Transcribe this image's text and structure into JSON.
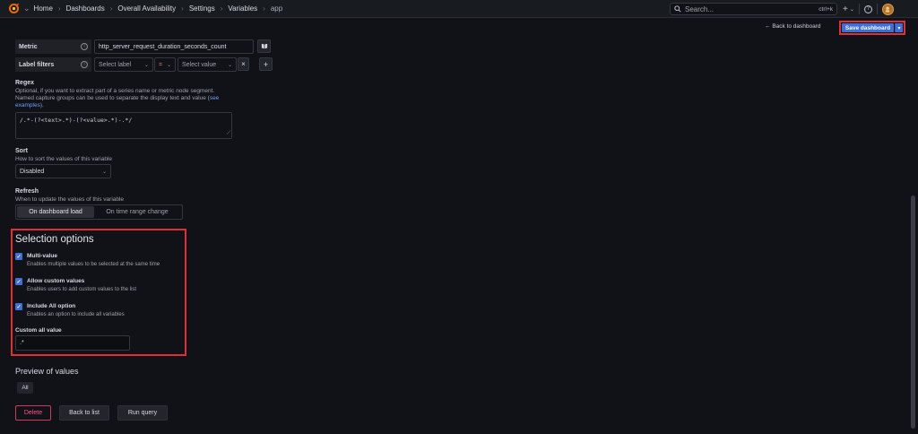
{
  "nav": {
    "breadcrumbs": [
      "Home",
      "Dashboards",
      "Overall Availability",
      "Settings",
      "Variables",
      "app"
    ],
    "search_placeholder": "Search...",
    "search_shortcut": "ctrl+k",
    "add_label": "+",
    "help_label": "?"
  },
  "toolbar": {
    "back_to_dashboard": "Back to dashboard",
    "save_dashboard": "Save dashboard"
  },
  "query": {
    "metric_label": "Metric",
    "metric_value": "http_server_request_duration_seconds_count",
    "label_filters_label": "Label filters",
    "select_label_placeholder": "Select label",
    "operator": "=",
    "select_value_placeholder": "Select value"
  },
  "regex": {
    "label": "Regex",
    "description_1": "Optional, if you want to extract part of a series name or metric node segment.",
    "description_2": "Named capture groups can be used to separate the display text and value (",
    "link_text_1": "see",
    "link_text_2": "examples",
    "description_end": ").",
    "value": "/.*-(?<text>.*)-(?<value>.*)-.*/"
  },
  "sort": {
    "label": "Sort",
    "description": "How to sort the values of this variable",
    "value": "Disabled"
  },
  "refresh": {
    "label": "Refresh",
    "description": "When to update the values of this variable",
    "options": [
      "On dashboard load",
      "On time range change"
    ],
    "selected": "On dashboard load"
  },
  "selection": {
    "title": "Selection options",
    "multi_value_label": "Multi-value",
    "multi_value_desc": "Enables multiple values to be selected at the same time",
    "custom_values_label": "Allow custom values",
    "custom_values_desc": "Enables users to add custom values to the list",
    "include_all_label": "Include All option",
    "include_all_desc": "Enables an option to include all variables",
    "custom_all_label": "Custom all value",
    "custom_all_value": ".*"
  },
  "preview": {
    "title": "Preview of values",
    "values": [
      "All"
    ]
  },
  "actions": {
    "delete": "Delete",
    "back_to_list": "Back to list",
    "run_query": "Run query"
  },
  "colors": {
    "accent": "#3d71d9",
    "highlight": "#e02f35",
    "danger": "#ff5286",
    "background": "#111217"
  }
}
